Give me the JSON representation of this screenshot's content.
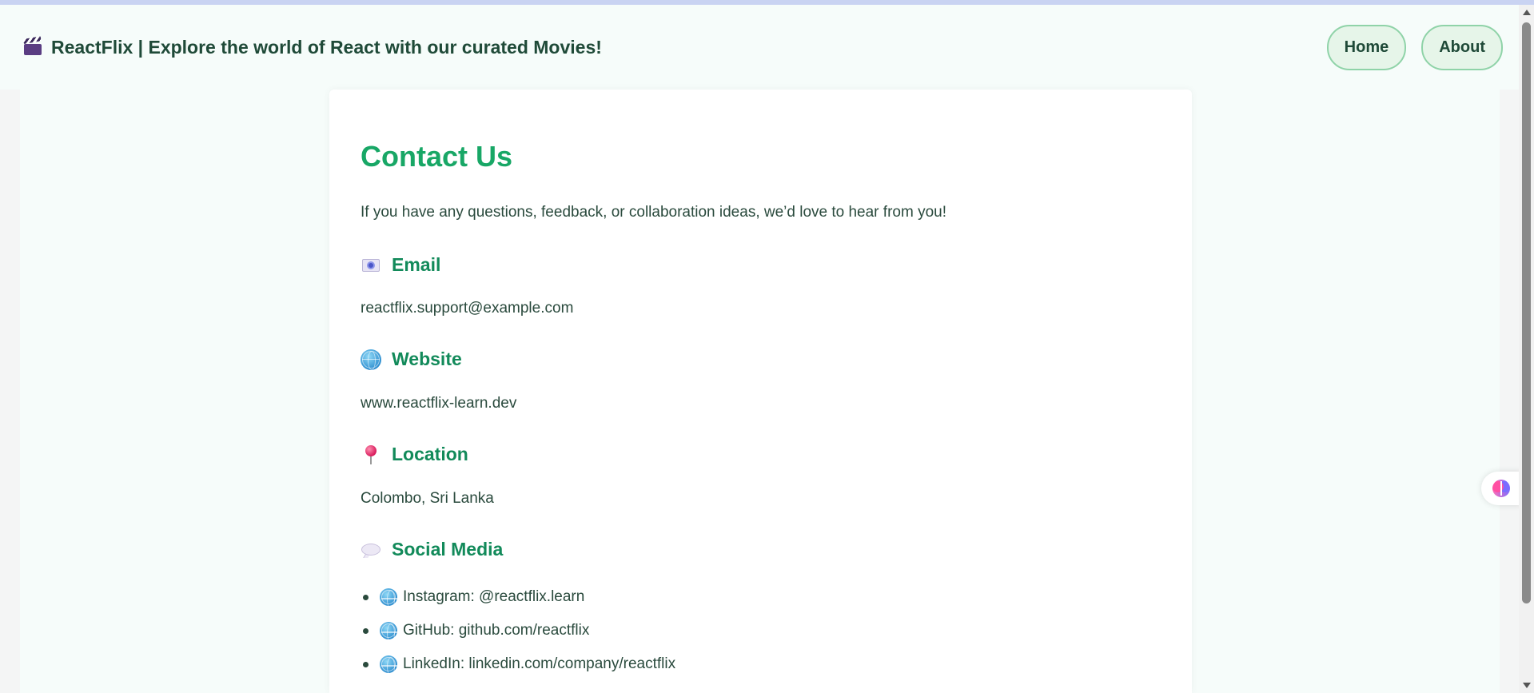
{
  "header": {
    "title": "ReactFlix | Explore the world of React with our curated Movies!",
    "brand_icon": "clapperboard-icon",
    "nav": [
      {
        "label": "Home"
      },
      {
        "label": "About"
      }
    ]
  },
  "contact": {
    "title": "Contact Us",
    "intro": "If you have any questions, feedback, or collaboration ideas, we’d love to hear from you!",
    "email": {
      "heading": "Email",
      "value": "reactflix.support@example.com",
      "icon": "envelope-icon"
    },
    "website": {
      "heading": "Website",
      "value": "www.reactflix-learn.dev",
      "icon": "globe-icon"
    },
    "location": {
      "heading": "Location",
      "value": "Colombo, Sri Lanka",
      "icon": "pin-icon"
    },
    "social": {
      "heading": "Social Media",
      "icon": "speech-bubble-icon",
      "items": [
        {
          "text": "Instagram: @reactflix.learn",
          "icon": "globe-icon"
        },
        {
          "text": "GitHub: github.com/reactflix",
          "icon": "globe-icon"
        },
        {
          "text": "LinkedIn: linkedin.com/company/reactflix",
          "icon": "globe-icon"
        }
      ]
    }
  },
  "widget": {
    "icon": "brain-icon"
  },
  "colors": {
    "accent_green": "#18a766",
    "heading_green": "#128a5a",
    "text_dark": "#2a4a3d",
    "nav_bg": "#e6f5e9",
    "nav_border": "#8fd3a8",
    "page_bg": "#f6fcfa"
  }
}
